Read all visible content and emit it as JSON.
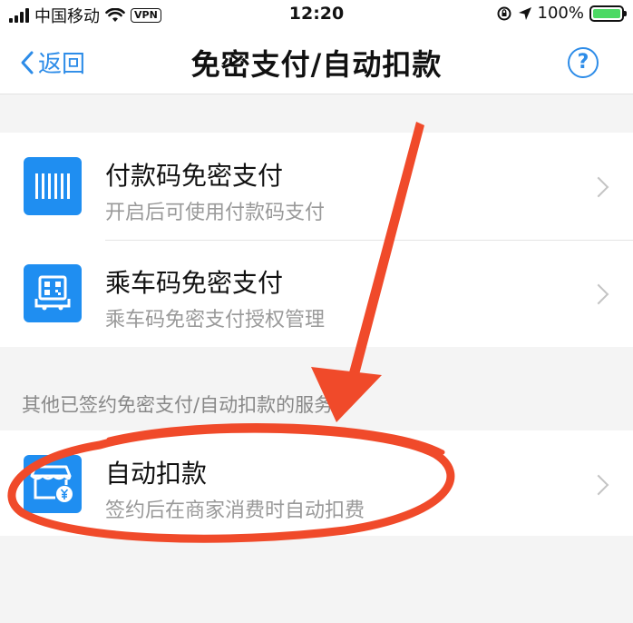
{
  "status_bar": {
    "carrier": "中国移动",
    "vpn": "VPN",
    "time": "12:20",
    "battery": "100%",
    "battery_level": 1.0
  },
  "nav": {
    "back_label": "返回",
    "title": "免密支付/自动扣款",
    "help_label": "?"
  },
  "items": [
    {
      "title": "付款码免密支付",
      "subtitle": "开启后可使用付款码支付",
      "icon": "barcode-icon"
    },
    {
      "title": "乘车码免密支付",
      "subtitle": "乘车码免密支付授权管理",
      "icon": "bus-code-icon"
    }
  ],
  "section": {
    "label": "其他已签约免密支付/自动扣款的服务"
  },
  "auto_item": {
    "title": "自动扣款",
    "subtitle": "签约后在商家消费时自动扣费",
    "icon": "store-yen-icon"
  },
  "colors": {
    "accent": "#2d8ce8",
    "icon_bg": "#1f8ef1",
    "annotation": "#f04a2a"
  }
}
